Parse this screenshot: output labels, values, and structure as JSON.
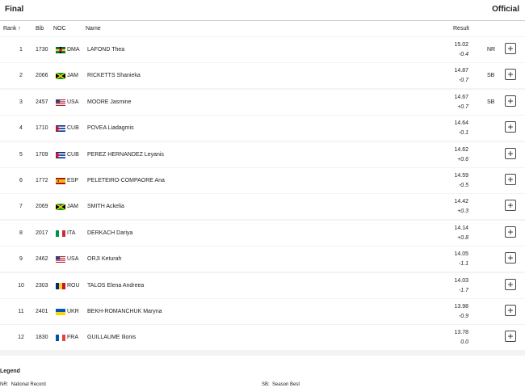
{
  "header": {
    "title": "Final",
    "status": "Official"
  },
  "columns": {
    "rank": "Rank",
    "sort_arrow": "↑",
    "bib": "Bib",
    "noc": "NOC",
    "name": "Name",
    "result": "Result"
  },
  "rows": [
    {
      "rank": "1",
      "bib": "1730",
      "noc": "DMA",
      "name": "LAFOND Thea",
      "result": "15.02",
      "wind": "-0.4",
      "mark": "NR"
    },
    {
      "rank": "2",
      "bib": "2066",
      "noc": "JAM",
      "name": "RICKETTS Shanieka",
      "result": "14.87",
      "wind": "-0.7",
      "mark": "SB"
    },
    {
      "rank": "3",
      "bib": "2457",
      "noc": "USA",
      "name": "MOORE Jasmine",
      "result": "14.67",
      "wind": "+0.7",
      "mark": "SB"
    },
    {
      "rank": "4",
      "bib": "1710",
      "noc": "CUB",
      "name": "POVEA Liadagmis",
      "result": "14.64",
      "wind": "-0.1",
      "mark": ""
    },
    {
      "rank": "5",
      "bib": "1709",
      "noc": "CUB",
      "name": "PEREZ HERNANDEZ Leyanis",
      "result": "14.62",
      "wind": "+0.6",
      "mark": ""
    },
    {
      "rank": "6",
      "bib": "1772",
      "noc": "ESP",
      "name": "PELETEIRO-COMPAORE Ana",
      "result": "14.59",
      "wind": "-0.5",
      "mark": ""
    },
    {
      "rank": "7",
      "bib": "2069",
      "noc": "JAM",
      "name": "SMITH Ackelia",
      "result": "14.42",
      "wind": "+0.3",
      "mark": ""
    },
    {
      "rank": "8",
      "bib": "2017",
      "noc": "ITA",
      "name": "DERKACH Dariya",
      "result": "14.14",
      "wind": "+0.8",
      "mark": ""
    },
    {
      "rank": "9",
      "bib": "2462",
      "noc": "USA",
      "name": "ORJI Keturah",
      "result": "14.05",
      "wind": "-1.1",
      "mark": ""
    },
    {
      "rank": "10",
      "bib": "2303",
      "noc": "ROU",
      "name": "TALOS Elena Andreea",
      "result": "14.03",
      "wind": "-1.7",
      "mark": ""
    },
    {
      "rank": "11",
      "bib": "2401",
      "noc": "UKR",
      "name": "BEKH-ROMANCHUK Maryna",
      "result": "13.98",
      "wind": "-0.9",
      "mark": ""
    },
    {
      "rank": "12",
      "bib": "1830",
      "noc": "FRA",
      "name": "GUILLAUME Ilionis",
      "result": "13.78",
      "wind": "0.0",
      "mark": ""
    }
  ],
  "expand_button_label": "+",
  "legend": {
    "title": "Legend",
    "items": [
      {
        "code": "NR:",
        "text": "National Record"
      },
      {
        "code": "SB:",
        "text": "Season Best"
      }
    ]
  },
  "colors": {
    "row_bg": "#ffffff",
    "gap_bg": "#f3f3f3",
    "divider": "#cccccc"
  }
}
